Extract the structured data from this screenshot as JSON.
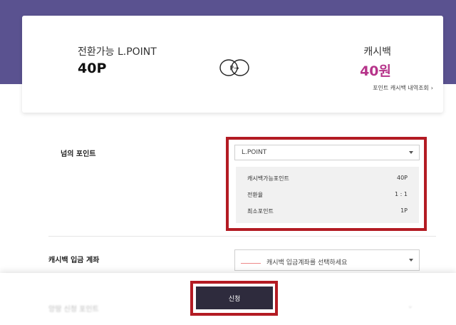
{
  "summary": {
    "from_label": "전환가능 L.POINT",
    "from_value": "40P",
    "swap_icon_text": "P→",
    "to_label": "캐시백",
    "to_value": "40원",
    "history_link": "포인트 캐시백 내역조회",
    "accent_color": "#b6348a",
    "band_color": "#5a5290"
  },
  "point_section": {
    "label": "넘의 포인트",
    "select_value": "L.POINT",
    "info": [
      {
        "key": "캐시백가능포인트",
        "value": "40P"
      },
      {
        "key": "전환율",
        "value": "1 : 1"
      },
      {
        "key": "최소포인트",
        "value": "1P"
      }
    ]
  },
  "account_section": {
    "label": "캐시백 입금 계좌",
    "placeholder": "캐시백 입금계좌를 선택하세요",
    "bank_logo_icon": "bank-logo-icon"
  },
  "faded_section": {
    "label": "앙땅 신청 포인트"
  },
  "footer": {
    "apply_label": "신청",
    "highlight_color": "#b31b23"
  }
}
